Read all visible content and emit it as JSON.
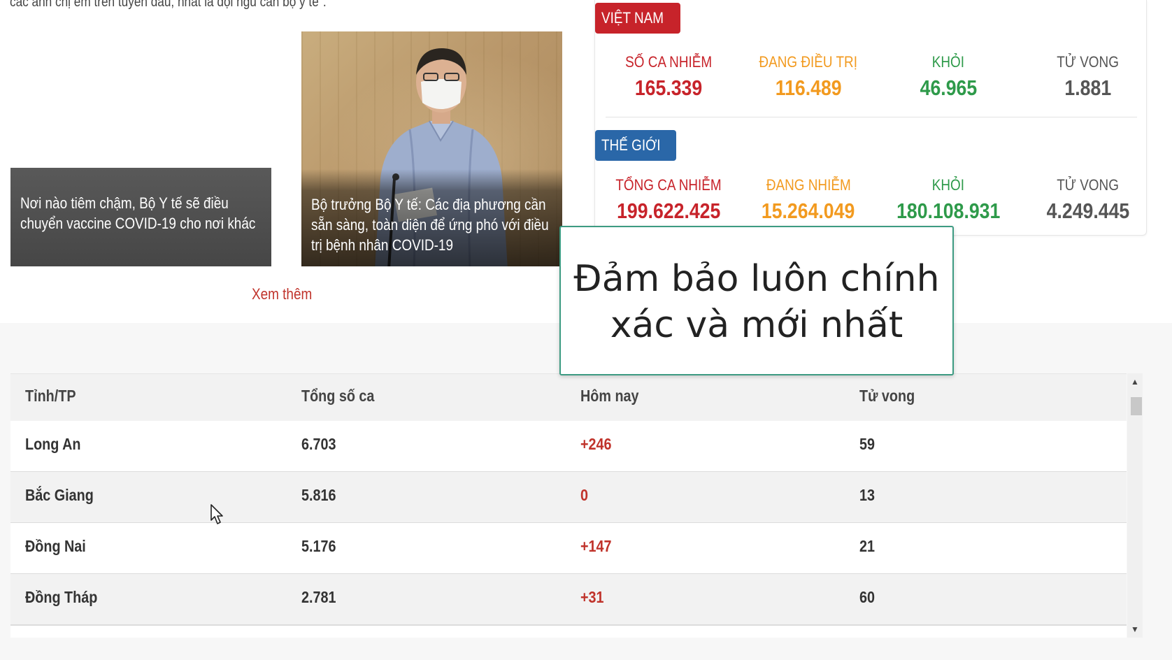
{
  "article": {
    "snippet": "các anh chị em trên tuyến đầu, nhất là đội ngũ cán bộ y tế\"."
  },
  "news": [
    {
      "caption": "Nơi nào tiêm chậm, Bộ Y tế sẽ điều chuyển vaccine COVID-19 cho nơi khác"
    },
    {
      "caption": "Bộ trưởng Bộ Y tế: Các địa phương cần sẵn sàng, toàn diện để ứng phó với điều trị bệnh nhân COVID-19"
    }
  ],
  "see_more": "Xem thêm",
  "stats": {
    "vietnam": {
      "badge": "VIỆT NAM",
      "items": [
        {
          "label": "SỐ CA NHIỄM",
          "value": "165.339",
          "color": "#c7232a"
        },
        {
          "label": "ĐANG ĐIỀU TRỊ",
          "value": "116.489",
          "color": "#f29a1f"
        },
        {
          "label": "KHỎI",
          "value": "46.965",
          "color": "#2e9a4a"
        },
        {
          "label": "TỬ VONG",
          "value": "1.881",
          "color": "#555555"
        }
      ]
    },
    "world": {
      "badge": "THẾ GIỚI",
      "items": [
        {
          "label": "TỔNG CA NHIỄM",
          "value": "199.622.425",
          "color": "#c7232a"
        },
        {
          "label": "ĐANG NHIỄM",
          "value": "15.264.049",
          "color": "#f29a1f"
        },
        {
          "label": "KHỎI",
          "value": "180.108.931",
          "color": "#2e9a4a"
        },
        {
          "label": "TỬ VONG",
          "value": "4.249.445",
          "color": "#555555"
        }
      ]
    }
  },
  "callout": {
    "line1": "Đảm bảo luôn chính",
    "line2": "xác và mới nhất"
  },
  "table": {
    "headers": [
      "Tỉnh/TP",
      "Tổng số ca",
      "Hôm nay",
      "Tử vong"
    ],
    "rows": [
      {
        "province": "Long An",
        "total": "6.703",
        "today": "+246",
        "deaths": "59"
      },
      {
        "province": "Bắc Giang",
        "total": "5.816",
        "today": "0",
        "deaths": "13"
      },
      {
        "province": "Đồng Nai",
        "total": "5.176",
        "today": "+147",
        "deaths": "21"
      },
      {
        "province": "Đồng Tháp",
        "total": "2.781",
        "today": "+31",
        "deaths": "60"
      }
    ]
  },
  "scrollbar": {
    "up_icon": "▲",
    "down_icon": "▼"
  }
}
